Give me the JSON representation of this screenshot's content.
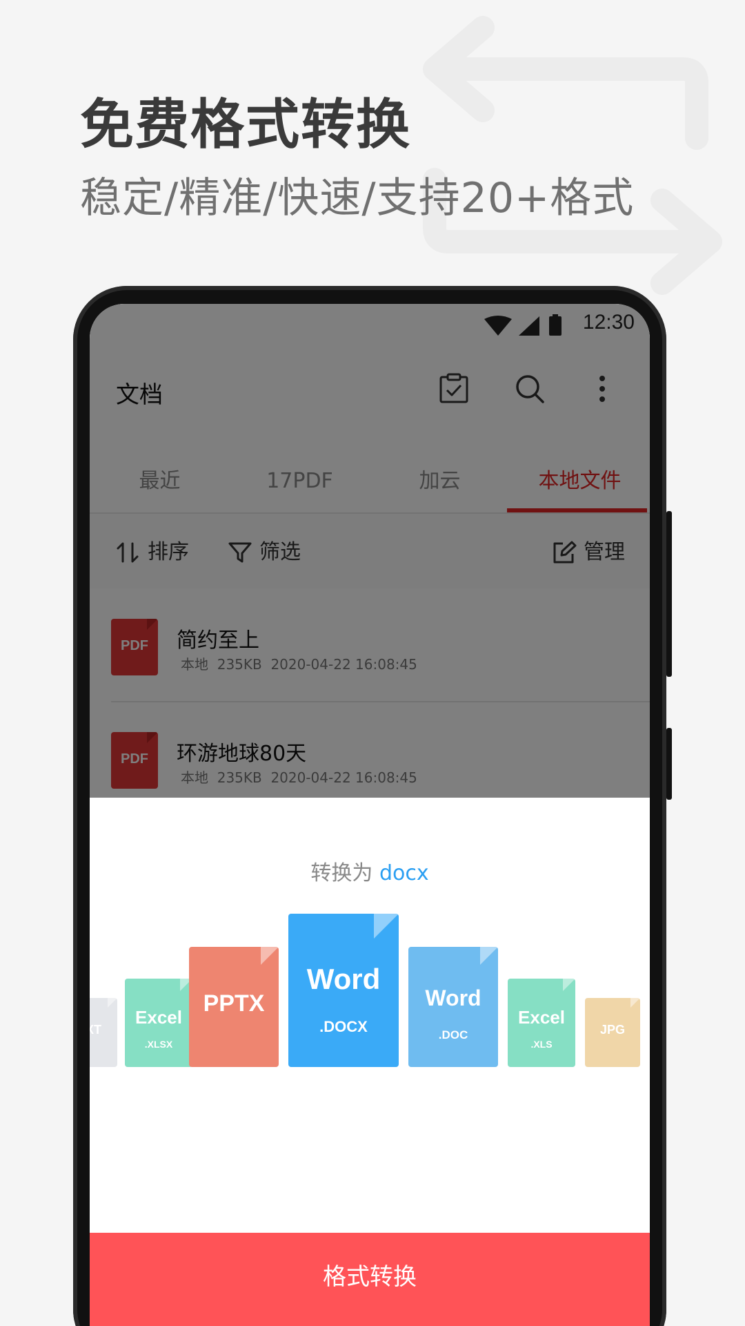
{
  "promo": {
    "headline": "免费格式转换",
    "subline": "稳定/精准/快速/支持20+格式"
  },
  "status_bar": {
    "time": "12:30"
  },
  "app": {
    "title": "文档",
    "icons": [
      "clipboard-check-icon",
      "search-icon",
      "more-vertical-icon"
    ],
    "tabs": [
      "最近",
      "17PDF",
      "加云",
      "本地文件"
    ],
    "active_tab": "本地文件",
    "filter_bar": {
      "sort": "排序",
      "filter": "筛选",
      "manage": "管理"
    },
    "files": [
      {
        "icon_label": "PDF",
        "name": "简约至上",
        "meta": "本地  235KB  2020-04-22 16:08:45"
      },
      {
        "icon_label": "PDF",
        "name": "环游地球80天",
        "meta": "本地  235KB  2020-04-22 16:08:45"
      }
    ]
  },
  "sheet": {
    "convert_prefix": "转换为 ",
    "convert_target": "docx",
    "formats": [
      {
        "main": "TXT",
        "ext": "",
        "color": "#e4e6ea"
      },
      {
        "main": "Excel",
        "ext": ".XLSX",
        "color": "#86dfc4"
      },
      {
        "main": "PPTX",
        "ext": "",
        "color": "#ee8570"
      },
      {
        "main": "Word",
        "ext": ".DOCX",
        "color": "#3aaaf7"
      },
      {
        "main": "Word",
        "ext": ".DOC",
        "color": "#6fbcf0"
      },
      {
        "main": "Excel",
        "ext": ".XLS",
        "color": "#86dfc4"
      },
      {
        "main": "JPG",
        "ext": "",
        "color": "#f0d6a8"
      }
    ],
    "selected_format": "Word .DOCX",
    "button_label": "格式转换"
  },
  "colors": {
    "accent_red": "#e02424",
    "button_red": "#ff5357",
    "link_blue": "#2b9ff2"
  }
}
